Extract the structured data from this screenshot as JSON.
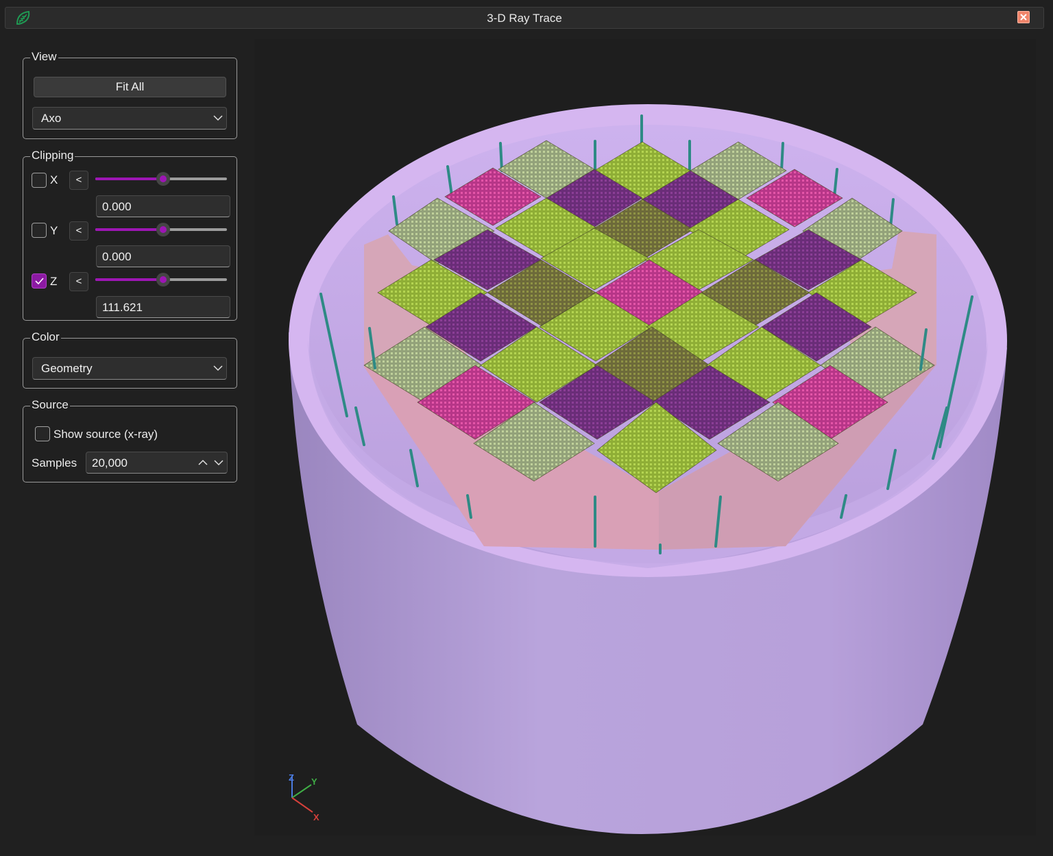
{
  "window": {
    "title": "3-D Ray Trace",
    "icon": "app-leaf-logo-icon",
    "close_icon": "close-icon"
  },
  "view": {
    "legend": "View",
    "fit_all_label": "Fit All",
    "projection": "Axo"
  },
  "clipping": {
    "legend": "Clipping",
    "axes": [
      {
        "label": "X",
        "checked": false,
        "direction_label": "<",
        "slider_position": 0.5,
        "value": "0.000"
      },
      {
        "label": "Y",
        "checked": false,
        "direction_label": "<",
        "slider_position": 0.5,
        "value": "0.000"
      },
      {
        "label": "Z",
        "checked": true,
        "direction_label": "<",
        "slider_position": 0.5,
        "value": "111.621"
      }
    ]
  },
  "color": {
    "legend": "Color",
    "mode": "Geometry"
  },
  "source": {
    "legend": "Source",
    "show_source_label": "Show source (x-ray)",
    "show_source_checked": false,
    "samples_label": "Samples",
    "samples_value": "20,000"
  },
  "scene": {
    "description_icon": "reactor-core-3d-render",
    "triad": {
      "x": "X",
      "y": "Y",
      "z": "Z"
    },
    "colors": {
      "vessel": "#b59ed8",
      "vessel_rim": "#d5b6f0",
      "assembly_side": "#d6a6b8",
      "fuel_green": "#9fc13d",
      "fuel_purple": "#7a2f86",
      "fuel_pink": "#d23f98",
      "rod": "#2e8a85",
      "accent": "#9d16b4"
    }
  }
}
